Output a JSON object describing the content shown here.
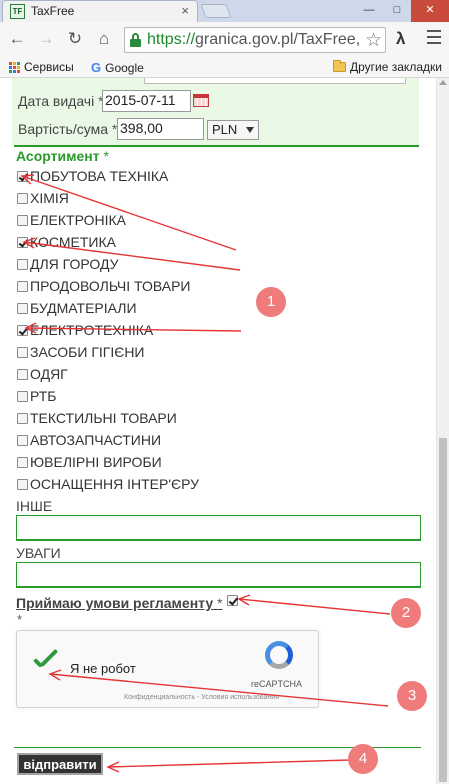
{
  "browser": {
    "tab_title": "TaxFree",
    "tab_favicon_text": "TF",
    "url_scheme": "https://",
    "url_rest": "granica.gov.pl/TaxFree,",
    "extension_label": "λ",
    "bookmarks": {
      "apps_label": "Сервисы",
      "google_label": "Google",
      "other_label": "Другие закладки"
    }
  },
  "form": {
    "issue_date_label": "Дата видачі",
    "issue_date_value": "2015-07-11",
    "amount_label": "Вартість/сума",
    "amount_value": "398,00",
    "currency_value": "PLN",
    "required_mark": "*",
    "assortment_title": "Асортимент",
    "items": [
      {
        "label": "ПОБУТОВА ТЕХНІКА",
        "checked": true
      },
      {
        "label": "ХІМІЯ",
        "checked": false
      },
      {
        "label": "ЕЛЕКТРОНІКА",
        "checked": false
      },
      {
        "label": "КОСМЕТИКА",
        "checked": true
      },
      {
        "label": "ДЛЯ ГОРОДУ",
        "checked": false
      },
      {
        "label": "ПРОДОВОЛЬЧІ ТОВАРИ",
        "checked": false
      },
      {
        "label": "БУДМАТЕРІАЛИ",
        "checked": false
      },
      {
        "label": "ЕЛЕКТРОТЕХНІКА",
        "checked": true
      },
      {
        "label": "ЗАСОБИ ГІГІЄНИ",
        "checked": false
      },
      {
        "label": "ОДЯГ",
        "checked": false
      },
      {
        "label": "РТБ",
        "checked": false
      },
      {
        "label": "ТЕКСТИЛЬНІ ТОВАРИ",
        "checked": false
      },
      {
        "label": "АВТОЗАПЧАСТИНИ",
        "checked": false
      },
      {
        "label": "ЮВЕЛІРНІ ВИРОБИ",
        "checked": false
      },
      {
        "label": "ОСНАЩЕННЯ ІНТЕР'ЄРУ",
        "checked": false
      }
    ],
    "other_label": "ІНШЕ",
    "other_value": "",
    "notes_label": "УВАГИ",
    "notes_value": "",
    "terms_label": "Приймаю умови регламенту",
    "terms_checked": true,
    "captcha_label": "Я не робот",
    "captcha_brand": "reCAPTCHA",
    "captcha_links": "Конфиденциальность - Условия использования",
    "submit_label": "відправити"
  },
  "annotations": {
    "callouts": [
      "1",
      "2",
      "3",
      "4"
    ],
    "color": "#e53535"
  }
}
